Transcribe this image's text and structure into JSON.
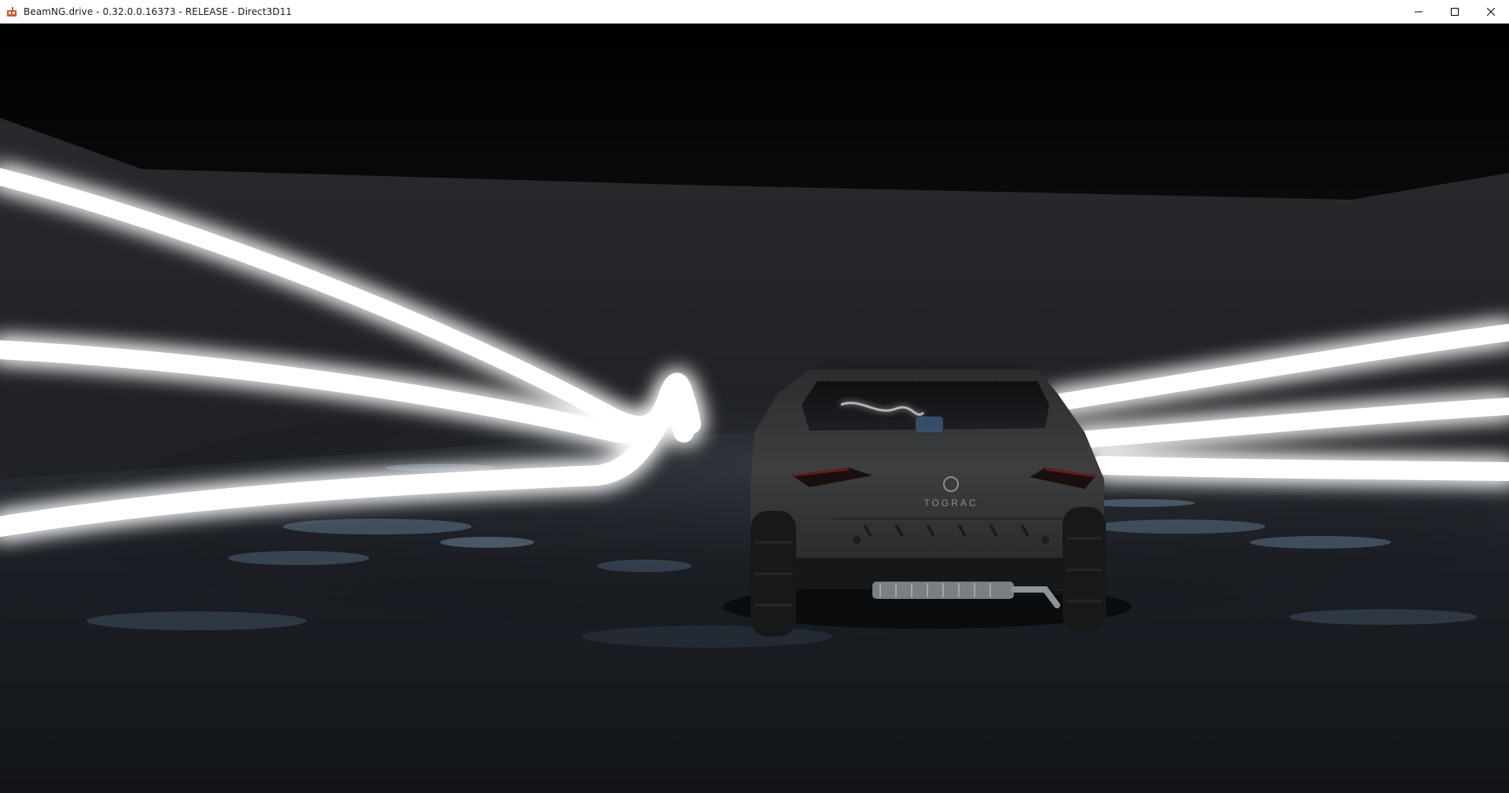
{
  "window": {
    "title": "BeamNG.drive - 0.32.0.0.16373 - RELEASE - Direct3D11",
    "app_icon": "beamng-logo-icon",
    "controls": {
      "minimize": "minimize-icon",
      "maximize": "maximize-icon",
      "close": "close-icon"
    }
  },
  "scene": {
    "vehicle_badge": "TOGRAC",
    "colors": {
      "light_strip": "#ffffff",
      "ceiling": "#000000",
      "wall": "#25272a",
      "floor": "#1a1d21",
      "vehicle_body": "#3a3b3d",
      "accent": "#e8521f"
    }
  }
}
